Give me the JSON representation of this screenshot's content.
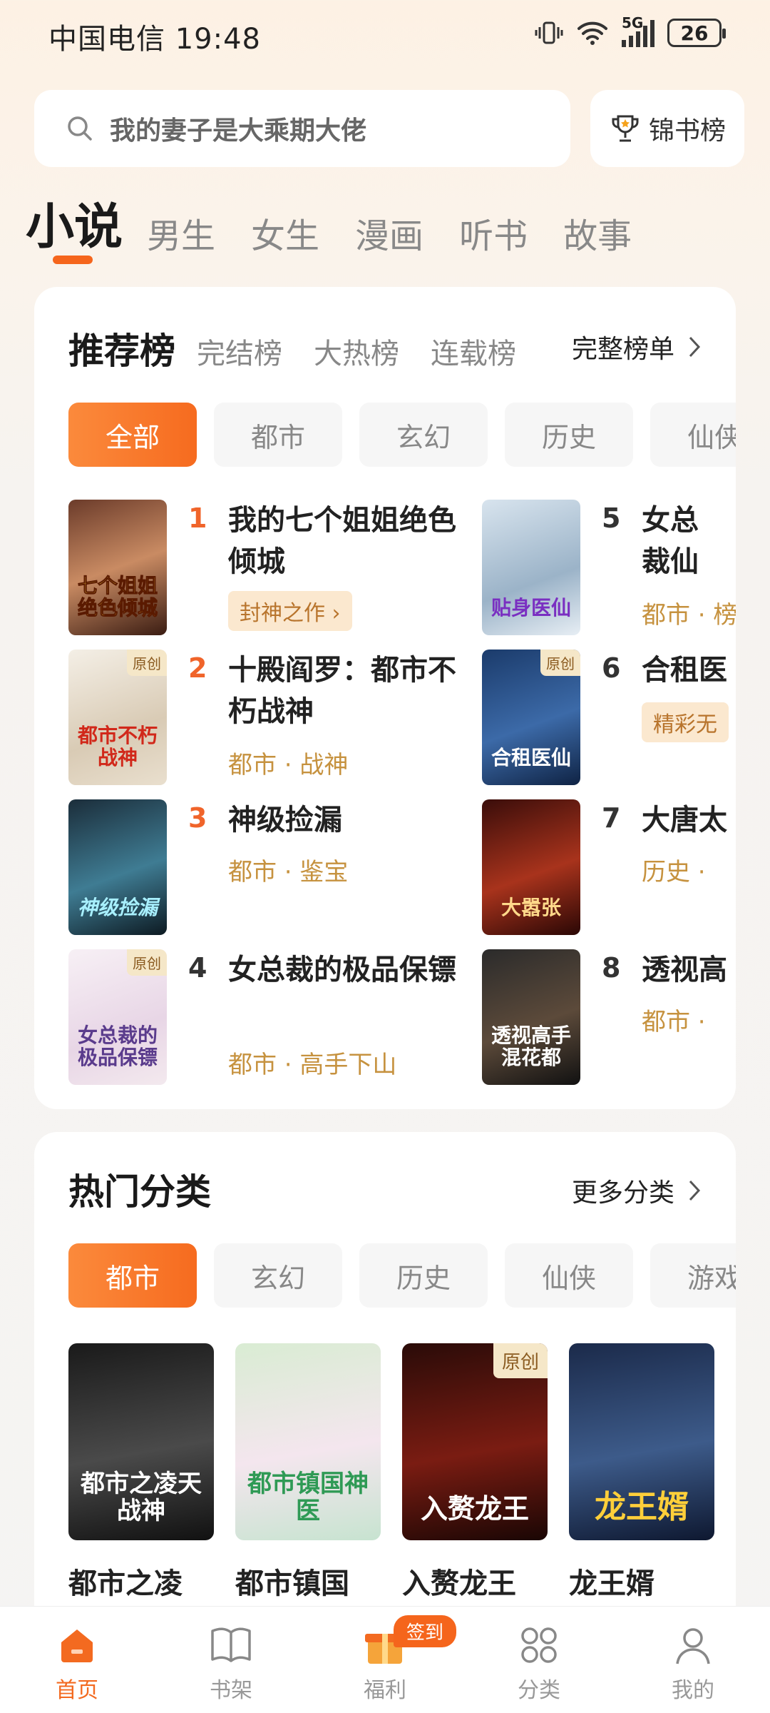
{
  "status_bar": {
    "carrier_time": "中国电信 19:48",
    "network": "5G",
    "battery": "26"
  },
  "search": {
    "placeholder": "我的妻子是大乘期大佬"
  },
  "rank_button": {
    "label": "锦书榜"
  },
  "main_tabs": [
    "小说",
    "男生",
    "女生",
    "漫画",
    "听书",
    "故事"
  ],
  "ranking": {
    "title": "推荐榜",
    "sub_tabs": [
      "完结榜",
      "大热榜",
      "连载榜"
    ],
    "full_list": "完整榜单",
    "chips": [
      "全部",
      "都市",
      "玄幻",
      "历史",
      "仙侠"
    ],
    "books": [
      {
        "rank": "1",
        "title": "我的七个姐姐绝色倾城",
        "badge": "封神之作 ›",
        "meta": "",
        "cover_text": "七个姐姐绝色倾城",
        "original": ""
      },
      {
        "rank": "2",
        "title": "十殿阎罗：都市不朽战神",
        "badge": "",
        "meta": "都市 · 战神",
        "cover_text": "都市不朽战神",
        "original": "原创"
      },
      {
        "rank": "3",
        "title": "神级捡漏",
        "badge": "",
        "meta": "都市 · 鉴宝",
        "cover_text": "神级捡漏",
        "original": ""
      },
      {
        "rank": "4",
        "title": "女总裁的极品保镖",
        "badge": "",
        "meta": "都市 · 高手下山",
        "cover_text": "女总裁的极品保镖",
        "original": "原创"
      },
      {
        "rank": "5",
        "title": "女总裁仙",
        "badge": "",
        "meta": "都市 · 榜",
        "cover_text": "贴身医仙",
        "original": ""
      },
      {
        "rank": "6",
        "title": "合租医",
        "badge": "精彩无",
        "meta": "",
        "cover_text": "合租医仙",
        "original": "原创"
      },
      {
        "rank": "7",
        "title": "大唐太",
        "badge": "",
        "meta": "历史 ·",
        "cover_text": "大嚣张",
        "original": ""
      },
      {
        "rank": "8",
        "title": "透视高",
        "badge": "",
        "meta": "都市 ·",
        "cover_text": "透视高手混花都",
        "original": ""
      }
    ]
  },
  "hot": {
    "title": "热门分类",
    "more": "更多分类",
    "chips": [
      "都市",
      "玄幻",
      "历史",
      "仙侠",
      "游戏"
    ],
    "books": [
      {
        "title": "都市之凌",
        "cover_text": "都市之凌天战神",
        "original": ""
      },
      {
        "title": "都市镇国",
        "cover_text": "都市镇国神医",
        "original": ""
      },
      {
        "title": "入赘龙王",
        "cover_text": "入赘龙王",
        "original": "原创"
      },
      {
        "title": "龙王婿",
        "cover_text": "龙王婿",
        "original": ""
      }
    ]
  },
  "bottom_nav": {
    "items": [
      "首页",
      "书架",
      "福利",
      "分类",
      "我的"
    ],
    "sign_badge": "签到"
  },
  "colors": {
    "accent": "#f5651c",
    "rank_top": "#f0642a",
    "meta": "#c6923f"
  }
}
